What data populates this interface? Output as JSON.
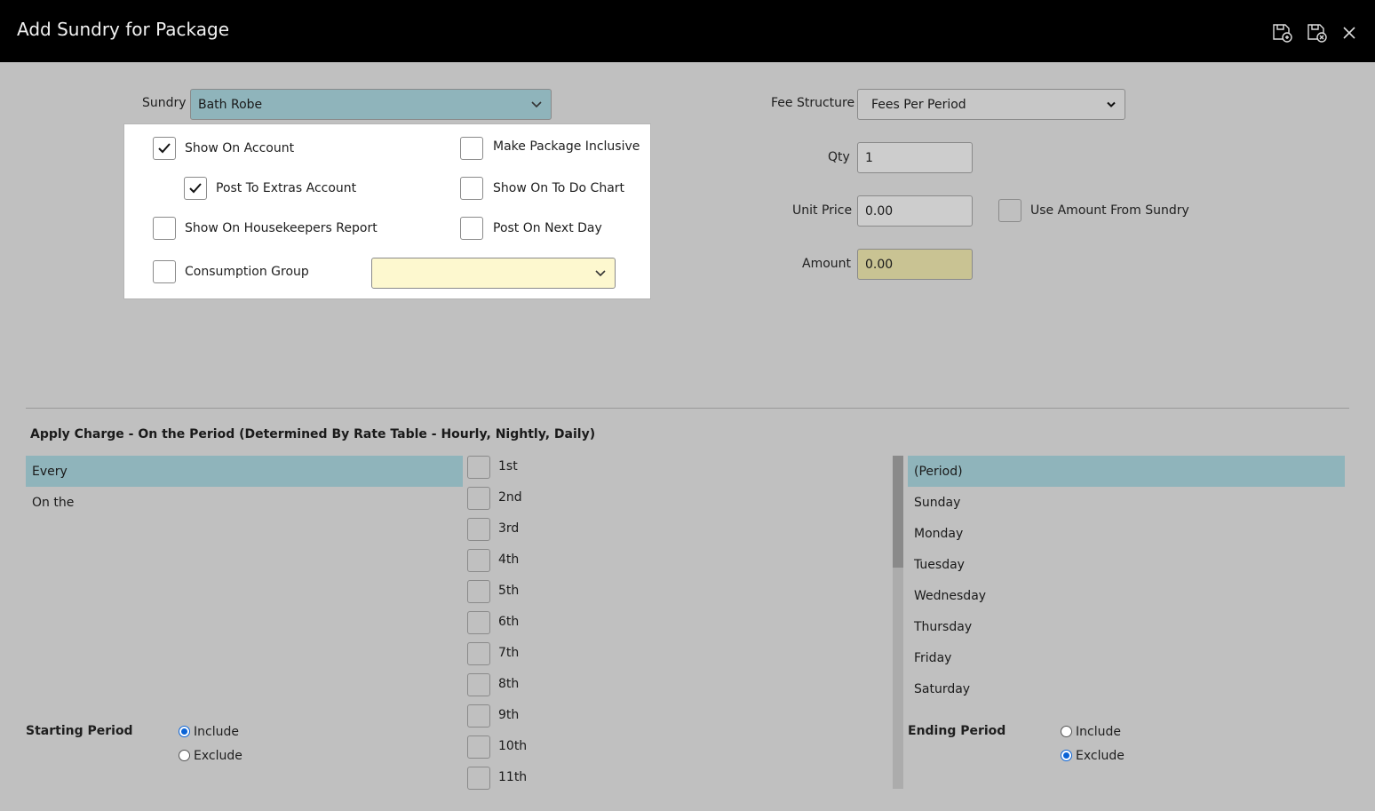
{
  "window": {
    "title": "Add Sundry for Package",
    "icons": [
      "save-copy-icon",
      "save-close-icon",
      "close-icon"
    ]
  },
  "sundry": {
    "label": "Sundry",
    "value": "Bath Robe"
  },
  "options": {
    "show_on_account": {
      "label": "Show On Account",
      "checked": true
    },
    "post_to_extras_account": {
      "label": "Post To Extras Account",
      "checked": true
    },
    "show_on_housekeepers_report": {
      "label": "Show On Housekeepers Report",
      "checked": false
    },
    "consumption_group": {
      "label": "Consumption Group",
      "checked": false,
      "value": ""
    },
    "make_package_inclusive": {
      "label": "Make Package Inclusive",
      "checked": false
    },
    "show_on_to_do_chart": {
      "label": "Show On To Do Chart",
      "checked": false
    },
    "post_on_next_day": {
      "label": "Post On Next Day",
      "checked": false
    }
  },
  "fees": {
    "fee_structure_label": "Fee Structure",
    "fee_structure_value": "Fees Per Period",
    "qty_label": "Qty",
    "qty_value": "1",
    "unit_price_label": "Unit Price",
    "unit_price_value": "0.00",
    "use_amount_label": "Use Amount From Sundry",
    "amount_label": "Amount",
    "amount_value": "0.00"
  },
  "apply_charge": {
    "title": "Apply Charge - On the Period (Determined By Rate Table - Hourly, Nightly, Daily)",
    "frequency": [
      "Every",
      "On the"
    ],
    "ordinals": [
      "1st",
      "2nd",
      "3rd",
      "4th",
      "5th",
      "6th",
      "7th",
      "8th",
      "9th",
      "10th",
      "11th"
    ],
    "days": [
      "(Period)",
      "Sunday",
      "Monday",
      "Tuesday",
      "Wednesday",
      "Thursday",
      "Friday",
      "Saturday"
    ]
  },
  "starting_period": {
    "label": "Starting Period",
    "include": "Include",
    "exclude": "Exclude",
    "selected": "Include"
  },
  "ending_period": {
    "label": "Ending Period",
    "include": "Include",
    "exclude": "Exclude",
    "selected": "Exclude"
  },
  "colors": {
    "selected_row": "#8fb4bb",
    "amount_bg": "#c9c393",
    "consumption_bg": "#fdf8cf",
    "radio_on": "#0a63d6"
  }
}
